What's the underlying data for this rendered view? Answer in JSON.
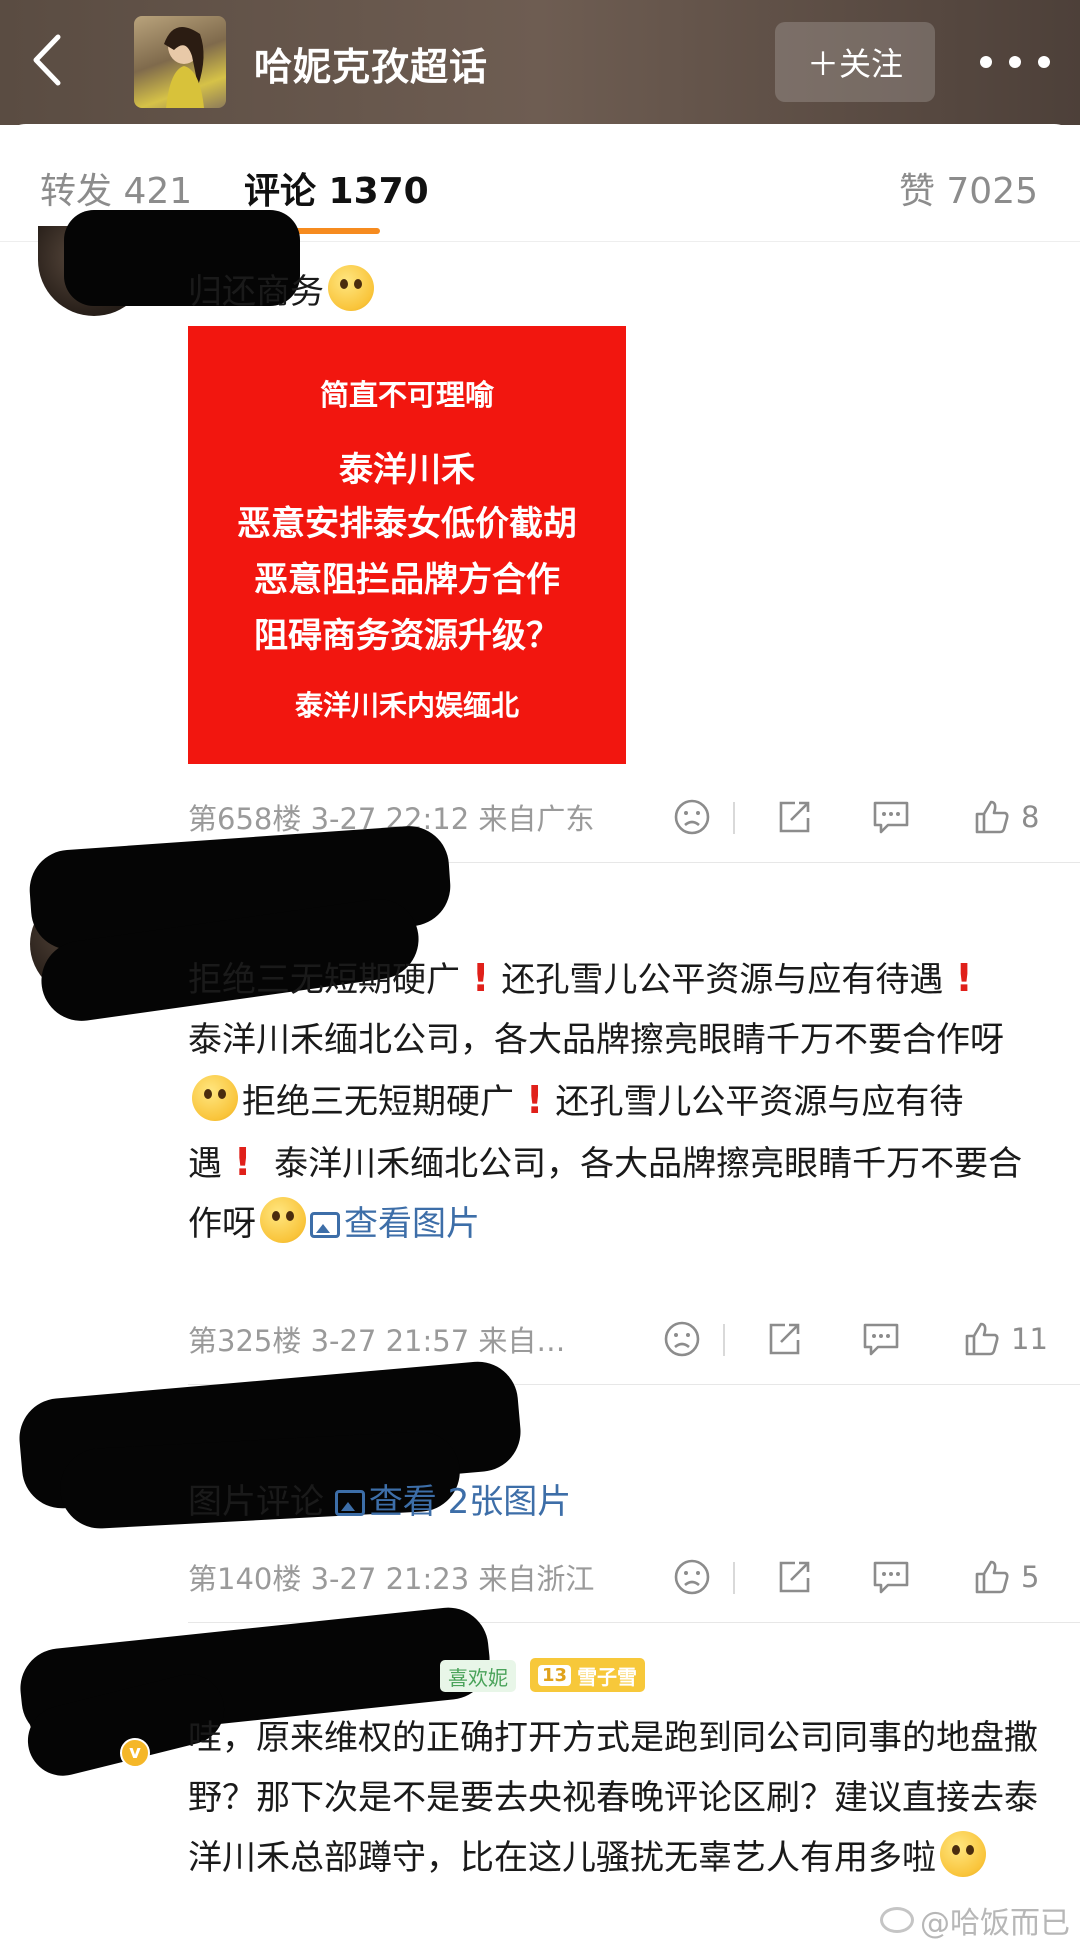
{
  "header": {
    "topic_title": "哈妮克孜超话",
    "follow_label": "＋关注"
  },
  "tabs": {
    "repost": "转发 421",
    "comment": "评论 1370",
    "like": "赞 7025"
  },
  "comments": [
    {
      "text": "归还商务",
      "poster": {
        "line1": "简直不可理喻",
        "line2": "泰洋川禾",
        "line3": "恶意安排泰女低价截胡",
        "line4": "恶意阻拦品牌方合作",
        "line5": "阻碍商务资源升级？",
        "line6": "泰洋川禾内娱缅北"
      },
      "meta": "第658楼 3-27 22:12 来自广东",
      "likes": "8"
    },
    {
      "seg1": "拒绝三无短期硬广",
      "seg2": "还孔雪儿公平资源与应有待遇",
      "seg3": "泰洋川禾缅北公司，各大品牌擦亮眼睛千万不要合作呀",
      "seg4": "拒绝三无短期硬广",
      "seg5": "还孔雪儿公平资源与应有待遇",
      "seg6": "泰洋川禾缅北公司，各大品牌擦亮眼睛千万不要合作呀",
      "link": "查看图片",
      "meta": "第325楼 3-27 21:57 来自…",
      "likes": "11"
    },
    {
      "text": "图片评论",
      "link": "查看 2张图片",
      "meta": "第140楼 3-27 21:23 来自浙江",
      "likes": "5"
    },
    {
      "badge_fan": "喜欢妮",
      "badge_level": "13",
      "badge_name": "雪子雪",
      "vip": "v",
      "text": "哇，原来维权的正确打开方式是跑到同公司同事的地盘撒野？那下次是不是要去央视春晚评论区刷？建议直接去泰洋川禾总部蹲守，比在这儿骚扰无辜艺人有用多啦"
    }
  ],
  "watermark": "@哈饭而已",
  "colors": {
    "accent": "#f68b1f",
    "link": "#3d6ea8",
    "poster_bg": "#f2160f",
    "exclamation": "#e0201a"
  },
  "icons": [
    "back-arrow-icon",
    "more-dots-icon",
    "dislike-face-icon",
    "share-icon",
    "comment-bubble-icon",
    "thumbs-up-icon",
    "picture-icon",
    "weibo-logo-icon"
  ]
}
